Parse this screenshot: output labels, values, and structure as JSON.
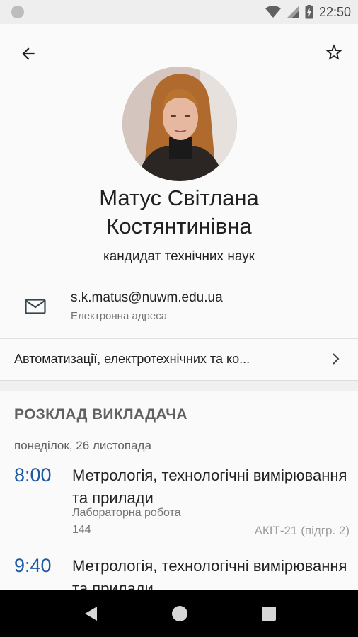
{
  "status_bar": {
    "time": "22:50",
    "icons": [
      "notification-dot-icon",
      "wifi-icon",
      "signal-icon",
      "battery-charging-icon"
    ]
  },
  "toolbar": {
    "back_icon": "arrow-back-icon",
    "favorite_icon": "star-outline-icon"
  },
  "profile": {
    "name_line1": "Матус Світлана",
    "name_line2": "Костянтинівна",
    "degree": "кандидат технічних наук",
    "email": "s.k.matus@nuwm.edu.ua",
    "email_label": "Електронна адреса",
    "department": "Автоматизації, електротехнічних та ко..."
  },
  "schedule": {
    "title": "РОЗКЛАД ВИКЛАДАЧА",
    "date": "понеділок, 26 листопада",
    "lessons": [
      {
        "time": "8:00",
        "subject": "Метрологія, технологічні вимірювання та прилади",
        "type": "Лабораторна робота",
        "room": "144",
        "group": "АКІТ-21 (підгр. 2)"
      },
      {
        "time": "9:40",
        "subject": "Метрологія, технологічні вимірювання та прилади"
      }
    ]
  },
  "colors": {
    "accent_time": "#1e5aa0",
    "nav_bar": "#000000"
  }
}
